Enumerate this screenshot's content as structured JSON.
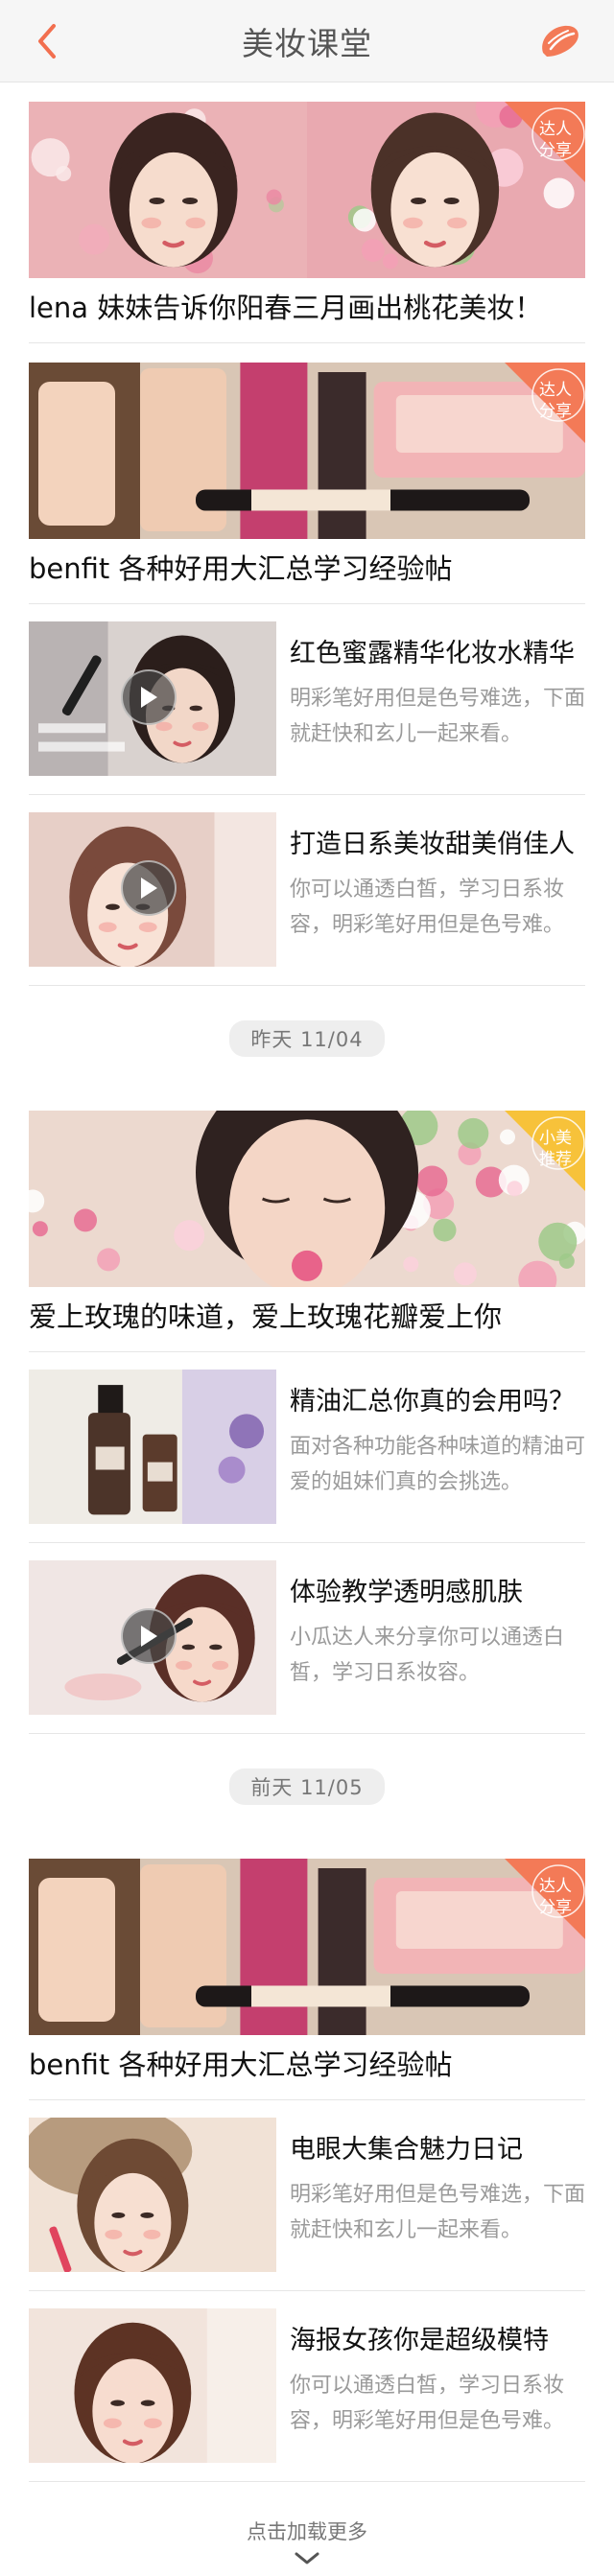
{
  "header": {
    "title": "美妆课堂",
    "accent_color": "#f26f4f"
  },
  "sections": [
    {
      "date_label": "",
      "feature_cards": [
        {
          "caption": "lena 妹妹告诉你阳春三月画出桃花美妆！",
          "badge": "达人分享",
          "badge_color": "#f37a57",
          "image": "two-women-portrait"
        },
        {
          "caption": "benfit 各种好用大汇总学习经验帖",
          "badge": "达人分享",
          "badge_color": "#f37a57",
          "image": "cosmetics-products"
        }
      ],
      "list_items": [
        {
          "title": "红色蜜露精华化妆水精华",
          "desc": "明彩笔好用但是色号难选，下面就赶快和玄儿一起来看。",
          "video": true,
          "image": "makeup-video"
        },
        {
          "title": "打造日系美妆甜美俏佳人",
          "desc": "你可以通透白皙，学习日系妆容，明彩笔好用但是色号难。",
          "video": true,
          "image": "sweet-girl"
        }
      ]
    },
    {
      "date_label": "昨天 11/04",
      "feature_cards": [
        {
          "caption": "爱上玫瑰的味道，爱上玫瑰花瓣爱上你",
          "badge": "小美推荐",
          "badge_color": "#f7c23a",
          "image": "rose-woman"
        }
      ],
      "list_items": [
        {
          "title": "精油汇总你真的会用吗？",
          "desc": "面对各种功能各种味道的精油可爱的姐妹们真的会挑选。",
          "video": false,
          "image": "oil-bottles"
        },
        {
          "title": "体验教学透明感肌肤",
          "desc": "小瓜达人来分享你可以通透白皙，学习日系妆容。",
          "video": true,
          "image": "lip-tutorial"
        }
      ]
    },
    {
      "date_label": "前天 11/05",
      "feature_cards": [
        {
          "caption": "benfit 各种好用大汇总学习经验帖",
          "badge": "达人分享",
          "badge_color": "#f37a57",
          "image": "cosmetics-products"
        }
      ],
      "list_items": [
        {
          "title": "电眼大集合魅力日记",
          "desc": "明彩笔好用但是色号难选，下面就赶快和玄儿一起来看。",
          "video": false,
          "image": "hat-girl"
        },
        {
          "title": "海报女孩你是超级模特",
          "desc": "你可以通透白皙，学习日系妆容，明彩笔好用但是色号难。",
          "video": false,
          "image": "poster-girl"
        }
      ]
    }
  ],
  "footer": {
    "load_more": "点击加载更多"
  }
}
